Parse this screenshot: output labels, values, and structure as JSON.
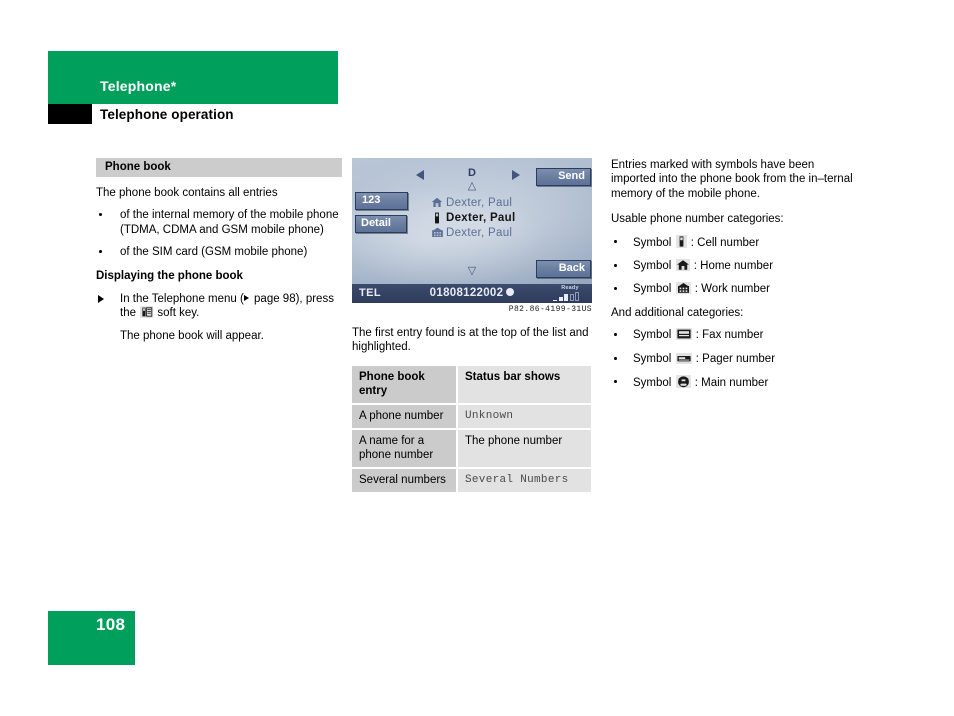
{
  "header": {
    "chapter_title": "Telephone*",
    "section_title": "Telephone operation",
    "accent_color": "#00a05c",
    "marker_color": "#000000"
  },
  "left_column": {
    "heading": "Phone book",
    "intro": "The phone book contains all entries",
    "bullets": [
      "of the internal memory of the mobile phone (TDMA, CDMA and GSM mobile phone)",
      "of the SIM card (GSM mobile phone)"
    ],
    "subheading": "Displaying the phone book",
    "step_prefix": "In the Telephone menu (",
    "step_ref": " page 98),",
    "step_suffix_a": "press the",
    "step_suffix_b": "soft key.",
    "step_icon": "phonebook-softkey-icon",
    "result": "The phone book will appear."
  },
  "middle_column": {
    "screen": {
      "softkeys": {
        "numeric": "123",
        "detail": "Detail",
        "send": "Send",
        "back": "Back"
      },
      "nav_letter": "D",
      "nav_left_icon": "left-arrow-icon",
      "nav_right_icon": "right-arrow-icon",
      "scroll_up_icon": "△",
      "scroll_down_icon": "▽",
      "entries": [
        {
          "icon": "home-number-icon",
          "name": "Dexter, Paul",
          "selected": false
        },
        {
          "icon": "cell-number-icon",
          "name": "Dexter, Paul",
          "selected": true
        },
        {
          "icon": "work-number-icon",
          "name": "Dexter, Paul",
          "selected": false
        }
      ],
      "status_bar": {
        "mode": "TEL",
        "number": "01808122002",
        "number_icon": "filled-circle-icon",
        "network_state": "Ready",
        "signal_icon": "signal-strength-icon"
      }
    },
    "figure_caption": "P82.86-4199-31US",
    "caption_text": "The first entry found is at the top of the list and highlighted.",
    "table": {
      "headers": [
        "Phone book entry",
        "Status bar shows"
      ],
      "rows": [
        {
          "entry": "A phone number",
          "status": "Unknown",
          "status_mono": true
        },
        {
          "entry": "A name for a phone number",
          "status": "The phone number",
          "status_mono": false
        },
        {
          "entry": "Several numbers",
          "status": "Several Numbers",
          "status_mono": true
        }
      ]
    }
  },
  "right_column": {
    "intro": "Entries marked with symbols have been imported into the phone book from the in–ternal memory of the mobile phone.",
    "usable_heading": "Usable phone number categories:",
    "usable_items": [
      {
        "prefix": "Symbol",
        "icon": "cell-number-icon",
        "label": ": Cell number"
      },
      {
        "prefix": "Symbol",
        "icon": "home-number-icon",
        "label": ": Home number"
      },
      {
        "prefix": "Symbol",
        "icon": "work-number-icon",
        "label": ": Work number"
      }
    ],
    "additional_heading": "And additional categories:",
    "additional_items": [
      {
        "prefix": "Symbol",
        "icon": "fax-number-icon",
        "label": ": Fax number"
      },
      {
        "prefix": "Symbol",
        "icon": "pager-number-icon",
        "label": ": Pager number"
      },
      {
        "prefix": "Symbol",
        "icon": "main-number-icon",
        "label": ": Main number"
      }
    ]
  },
  "footer": {
    "page_number": "108"
  }
}
